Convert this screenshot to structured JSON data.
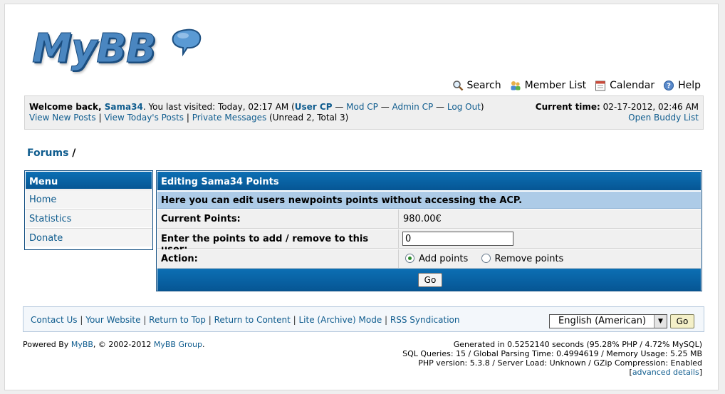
{
  "logo": {
    "text": "MyBB"
  },
  "topnav": [
    {
      "label": "Search",
      "icon": "magnifier-icon"
    },
    {
      "label": "Member List",
      "icon": "members-icon"
    },
    {
      "label": "Calendar",
      "icon": "calendar-icon"
    },
    {
      "label": "Help",
      "icon": "help-icon"
    }
  ],
  "welcome": {
    "prefix": "Welcome back, ",
    "username": "Sama34",
    "last_visit": ". You last visited: Today, 02:17 AM (",
    "user_cp": "User CP",
    "sep": " — ",
    "mod_cp": "Mod CP",
    "admin_cp": "Admin CP",
    "logout": "Log Out",
    "close": ")",
    "view_new": "View New Posts",
    "view_today": "View Today's Posts",
    "pm": "Private Messages",
    "pm_counts": " (Unread 2, Total 3)",
    "pipe": " | ",
    "time_label": "Current time:",
    "time_value": " 02-17-2012, 02:46 AM",
    "buddy": "Open Buddy List"
  },
  "breadcrumb": {
    "forums": "Forums",
    "slash": " /"
  },
  "menu": {
    "title": "Menu",
    "items": [
      "Home",
      "Statistics",
      "Donate"
    ]
  },
  "editor": {
    "title": "Editing Sama34 Points",
    "subtitle": "Here you can edit users newpoints points without accessing the ACP.",
    "current_label": "Current Points:",
    "current_value": "980.00€",
    "enter_label": "Enter the points to add / remove to this user:",
    "enter_value": "0",
    "action_label": "Action:",
    "add_label": "Add points",
    "remove_label": "Remove points",
    "go": "Go"
  },
  "footer": {
    "links": [
      "Contact Us",
      "Your Website",
      "Return to Top",
      "Return to Content",
      "Lite (Archive) Mode",
      "RSS Syndication"
    ],
    "pipe": " | ",
    "language": "English (American)",
    "go": "Go"
  },
  "powered": {
    "prefix": "Powered By ",
    "mybb": "MyBB",
    "copy": ", © 2002-2012 ",
    "group": "MyBB Group",
    "dot": "."
  },
  "stats": {
    "line1": "Generated in 0.5252140 seconds (95.28% PHP / 4.72% MySQL)",
    "line2": "SQL Queries: 15 / Global Parsing Time: 0.4994619 / Memory Usage: 5.25 MB",
    "line3": "PHP version: 5.3.8 / Server Load: Unknown / GZip Compression: Enabled",
    "open": "[",
    "advanced": "advanced details",
    "close": "]"
  }
}
